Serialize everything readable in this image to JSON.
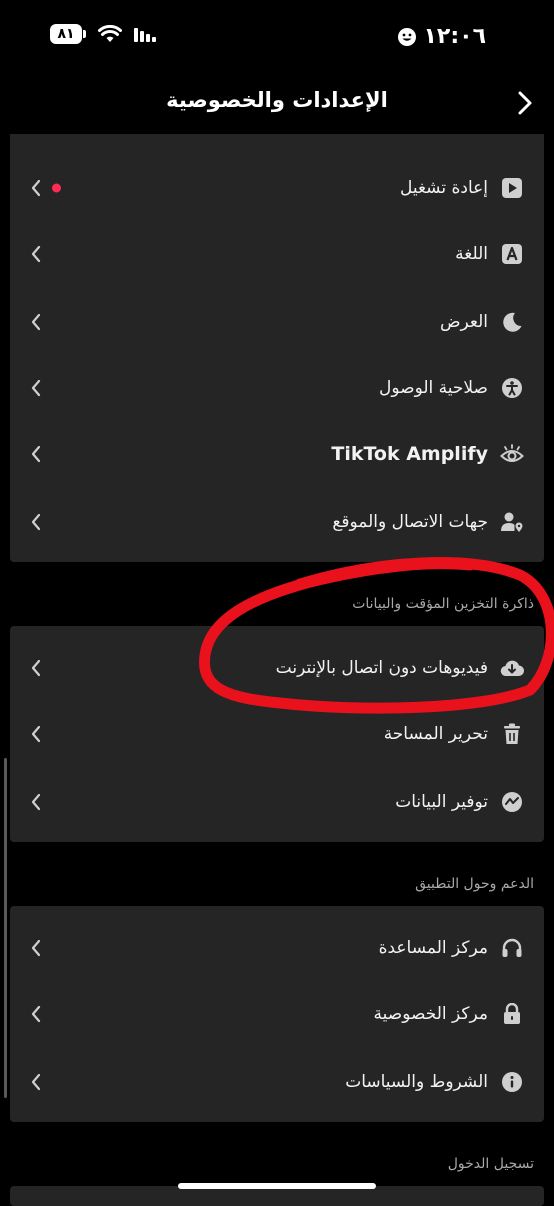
{
  "status_bar": {
    "time": "١٢:٠٦",
    "battery": "٨١"
  },
  "header": {
    "title": "الإعدادات والخصوصية"
  },
  "sections": {
    "top_items": [
      {
        "label": "إعادة تشغيل",
        "icon": "play-square-icon",
        "notification_dot": true
      },
      {
        "label": "اللغة",
        "icon": "letter-a-square-icon"
      },
      {
        "label": "العرض",
        "icon": "moon-icon"
      },
      {
        "label": "صلاحية الوصول",
        "icon": "accessibility-icon"
      },
      {
        "label": "TikTok Amplify",
        "icon": "eye-icon"
      },
      {
        "label": "جهات الاتصال والموقع",
        "icon": "user-location-icon"
      }
    ],
    "cache": {
      "title": "ذاكرة التخزين المؤقت والبيانات",
      "items": [
        {
          "label": "فيديوهات دون اتصال بالإنترنت",
          "icon": "cloud-download-icon"
        },
        {
          "label": "تحرير المساحة",
          "icon": "trash-icon"
        },
        {
          "label": "توفير البيانات",
          "icon": "data-saver-icon"
        }
      ]
    },
    "support": {
      "title": "الدعم وحول التطبيق",
      "items": [
        {
          "label": "مركز المساعدة",
          "icon": "headphones-icon"
        },
        {
          "label": "مركز الخصوصية",
          "icon": "lock-icon"
        },
        {
          "label": "الشروط والسياسات",
          "icon": "info-icon"
        }
      ]
    },
    "login": {
      "title": "تسجيل الدخول"
    }
  },
  "colors": {
    "accent_dot": "#fe2c55",
    "annotation": "#e8111c",
    "card_bg": "#252525"
  }
}
